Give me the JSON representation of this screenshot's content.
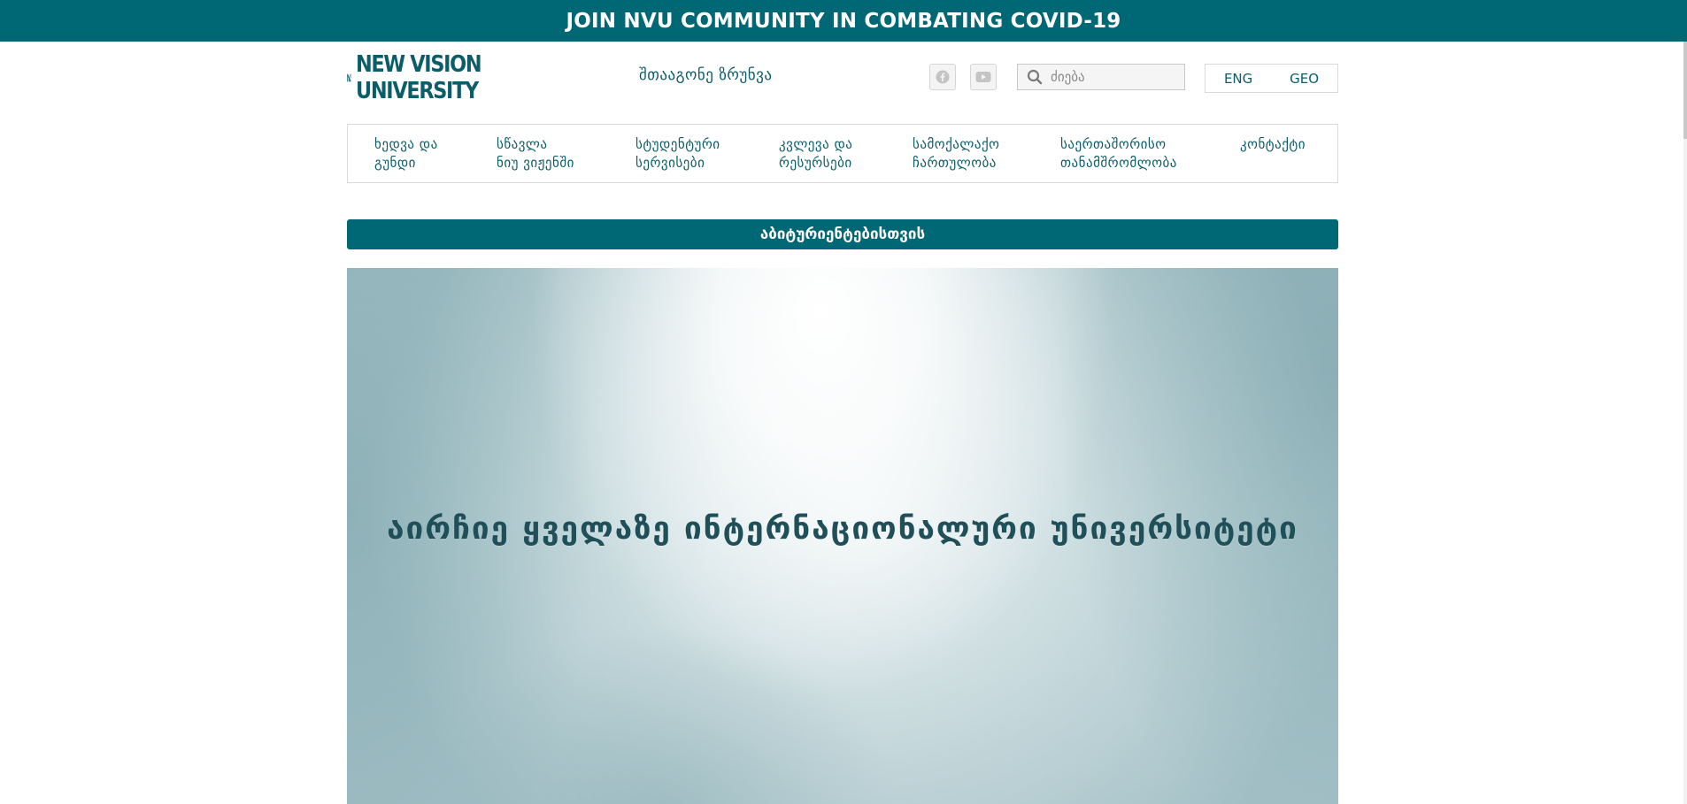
{
  "banner": {
    "text": "JOIN NVU COMMUNITY IN COMBATING COVID-19"
  },
  "header": {
    "logo": {
      "line1": "NEW VISION",
      "line2": "UNIVERSITY"
    },
    "apply_link": "შთააგონე ზრუნვა",
    "social": [
      {
        "name": "facebook",
        "icon": "facebook-icon"
      },
      {
        "name": "youtube",
        "icon": "youtube-icon"
      }
    ],
    "search": {
      "placeholder": "ძიება",
      "value": ""
    },
    "languages": [
      "ENG",
      "GEO"
    ]
  },
  "nav": {
    "items": [
      {
        "line1": "ხედვა და",
        "line2": "გუნდი"
      },
      {
        "line1": "სწავლა",
        "line2": "ნიუ ვიჟენში"
      },
      {
        "line1": "სტუდენტური",
        "line2": "სერვისები"
      },
      {
        "line1": "კვლევა და",
        "line2": "რესურსები"
      },
      {
        "line1": "სამოქალაქო",
        "line2": "ჩართულობა"
      },
      {
        "line1": "საერთაშორისო",
        "line2": "თანამშრომლობა"
      },
      {
        "line1": "კონტაქტი",
        "line2": ""
      }
    ]
  },
  "apply_bar": {
    "label": "აბიტურიენტებისთვის"
  },
  "hero": {
    "title": "აირჩიე ყველაზე ინტერნაციონალური უნივერსიტეტი"
  },
  "colors": {
    "brand": "#006774",
    "text": "#0b5d69",
    "border": "#d9d9d9"
  }
}
